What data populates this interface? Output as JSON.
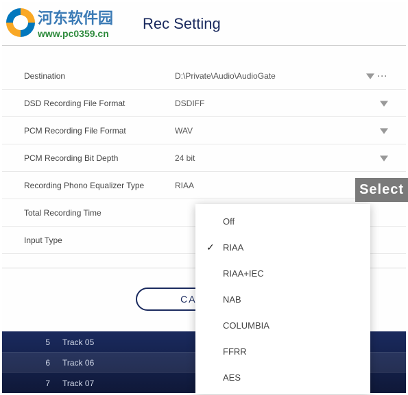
{
  "watermark": {
    "title": "河东软件园",
    "url": "www.pc0359.cn"
  },
  "header": {
    "title": "Rec Setting"
  },
  "fields": [
    {
      "label": "Destination",
      "value": "D:\\Private\\Audio\\AudioGate",
      "hasDropdown": true,
      "hasBrowse": true
    },
    {
      "label": "DSD Recording File Format",
      "value": "DSDIFF",
      "hasDropdown": true,
      "hasBrowse": false
    },
    {
      "label": "PCM Recording File Format",
      "value": "WAV",
      "hasDropdown": true,
      "hasBrowse": false
    },
    {
      "label": "PCM Recording Bit Depth",
      "value": "24 bit",
      "hasDropdown": true,
      "hasBrowse": false
    },
    {
      "label": "Recording Phono Equalizer Type",
      "value": "RIAA",
      "hasDropdown": true,
      "hasBrowse": false
    },
    {
      "label": "Total Recording Time",
      "value": "",
      "hasDropdown": false,
      "hasBrowse": false
    },
    {
      "label": "Input Type",
      "value": "",
      "hasDropdown": false,
      "hasBrowse": false
    }
  ],
  "buttons": {
    "cancel": "CANCEL"
  },
  "tracks": [
    {
      "num": "5",
      "name": "Track 05",
      "selected": false
    },
    {
      "num": "6",
      "name": "Track 06",
      "selected": true
    },
    {
      "num": "7",
      "name": "Track 07",
      "selected": false
    }
  ],
  "dropdown": {
    "options": [
      {
        "label": "Off",
        "checked": false
      },
      {
        "label": "RIAA",
        "checked": true
      },
      {
        "label": "RIAA+IEC",
        "checked": false
      },
      {
        "label": "NAB",
        "checked": false
      },
      {
        "label": "COLUMBIA",
        "checked": false
      },
      {
        "label": "FFRR",
        "checked": false
      },
      {
        "label": "AES",
        "checked": false
      }
    ]
  },
  "callout": {
    "text": "Select"
  }
}
